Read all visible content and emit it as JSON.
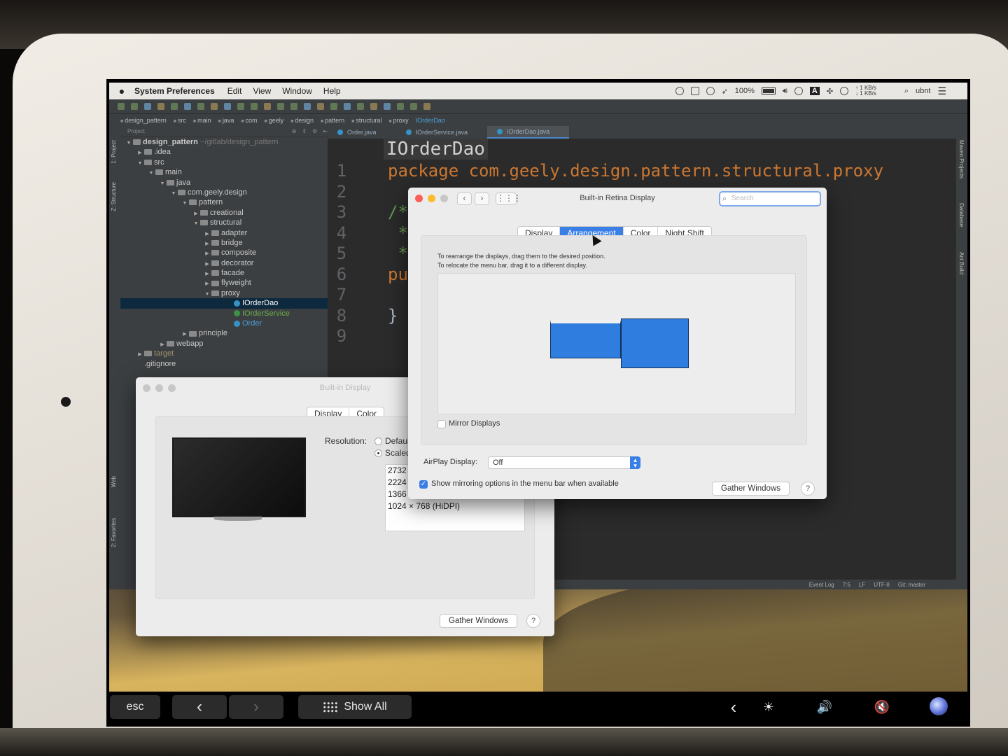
{
  "menubar": {
    "app_name": "System Preferences",
    "menus": [
      "Edit",
      "View",
      "Window",
      "Help"
    ],
    "battery_percent": "100%",
    "net_up": "↑ 1 KB/s",
    "net_down": "↓ 1 KB/s",
    "input_source": "A",
    "user": "ubnt"
  },
  "ide": {
    "breadcrumbs": [
      "design_pattern",
      "src",
      "main",
      "java",
      "com",
      "geely",
      "design",
      "pattern",
      "structural",
      "proxy",
      "IOrderDao"
    ],
    "panel_title": "Project",
    "tool_left": [
      "1: Project",
      "Z: Structure",
      "Web",
      "2: Favorites"
    ],
    "tool_right": [
      "Maven Projects",
      "Database",
      "Ant Build"
    ],
    "tree": [
      {
        "label": "design_pattern",
        "extra": "~/gitlab/design_pattern",
        "indent": 0,
        "arrow": "▼",
        "kind": "folder",
        "style": "bold"
      },
      {
        "label": ".idea",
        "indent": 1,
        "arrow": "▶",
        "kind": "folder"
      },
      {
        "label": "src",
        "indent": 1,
        "arrow": "▼",
        "kind": "folder"
      },
      {
        "label": "main",
        "indent": 2,
        "arrow": "▼",
        "kind": "folder"
      },
      {
        "label": "java",
        "indent": 3,
        "arrow": "▼",
        "kind": "folder"
      },
      {
        "label": "com.geely.design",
        "indent": 4,
        "arrow": "▼",
        "kind": "folder"
      },
      {
        "label": "pattern",
        "indent": 5,
        "arrow": "▼",
        "kind": "folder"
      },
      {
        "label": "creational",
        "indent": 6,
        "arrow": "▶",
        "kind": "folder"
      },
      {
        "label": "structural",
        "indent": 6,
        "arrow": "▼",
        "kind": "folder"
      },
      {
        "label": "adapter",
        "indent": 7,
        "arrow": "▶",
        "kind": "folder"
      },
      {
        "label": "bridge",
        "indent": 7,
        "arrow": "▶",
        "kind": "folder"
      },
      {
        "label": "composite",
        "indent": 7,
        "arrow": "▶",
        "kind": "folder"
      },
      {
        "label": "decorator",
        "indent": 7,
        "arrow": "▶",
        "kind": "folder"
      },
      {
        "label": "facade",
        "indent": 7,
        "arrow": "▶",
        "kind": "folder"
      },
      {
        "label": "flyweight",
        "indent": 7,
        "arrow": "▶",
        "kind": "folder"
      },
      {
        "label": "proxy",
        "indent": 7,
        "arrow": "▼",
        "kind": "folder"
      },
      {
        "label": "IOrderDao",
        "indent": 9,
        "arrow": "",
        "kind": "class",
        "style": "selected"
      },
      {
        "label": "IOrderService",
        "indent": 9,
        "arrow": "",
        "kind": "class-green",
        "style": "green"
      },
      {
        "label": "Order",
        "indent": 9,
        "arrow": "",
        "kind": "class",
        "style": "blue"
      },
      {
        "label": "principle",
        "indent": 5,
        "arrow": "▶",
        "kind": "folder"
      },
      {
        "label": "webapp",
        "indent": 3,
        "arrow": "▶",
        "kind": "folder"
      },
      {
        "label": "target",
        "indent": 1,
        "arrow": "▶",
        "kind": "folder",
        "style": "olive"
      },
      {
        "label": ".gitignore",
        "indent": 1,
        "arrow": "",
        "kind": "none"
      }
    ],
    "tabs": [
      "Order.java",
      "IOrderService.java",
      "IOrderDao.java"
    ],
    "code_title": "IOrderDao",
    "line_numbers": [
      "1",
      "2",
      "3",
      "4",
      "5",
      "6",
      "7",
      "8",
      "9"
    ],
    "code_package": "package com.geely.design.pattern.structural.proxy",
    "code_pu": "pu",
    "code_brace": "}",
    "status_right": [
      "7:5",
      "LF",
      "UTF-8",
      "Git: master"
    ],
    "event_log": "Event Log"
  },
  "retina_window": {
    "title": "Built-in Retina Display",
    "search_placeholder": "Search",
    "tabs": [
      "Display",
      "Arrangement",
      "Color",
      "Night Shift"
    ],
    "active_tab": "Arrangement",
    "instruction_1": "To rearrange the displays, drag them to the desired position.",
    "instruction_2": "To relocate the menu bar, drag it to a different display.",
    "mirror_label": "Mirror Displays",
    "mirror_checked": false,
    "airplay_label": "AirPlay Display:",
    "airplay_value": "Off",
    "show_mirroring_label": "Show mirroring options in the menu bar when available",
    "show_mirroring_checked": true,
    "gather_button": "Gather Windows",
    "help": "?"
  },
  "builtin_window": {
    "title": "Built-in Display",
    "tabs": [
      "Display",
      "Color"
    ],
    "resolution_label": "Resolution:",
    "options": [
      "Default",
      "Scaled"
    ],
    "resolutions": [
      "2732 ×",
      "2224 ×",
      "1366 ×",
      "1024 × 768 (HiDPI)"
    ],
    "gather_button": "Gather Windows",
    "help": "?"
  },
  "touchbar": {
    "esc": "esc",
    "back": "‹",
    "forward": "›",
    "show_all": "Show All",
    "collapse": "‹",
    "brightness": "☀",
    "volume": "🔊",
    "mute": "🔇"
  }
}
